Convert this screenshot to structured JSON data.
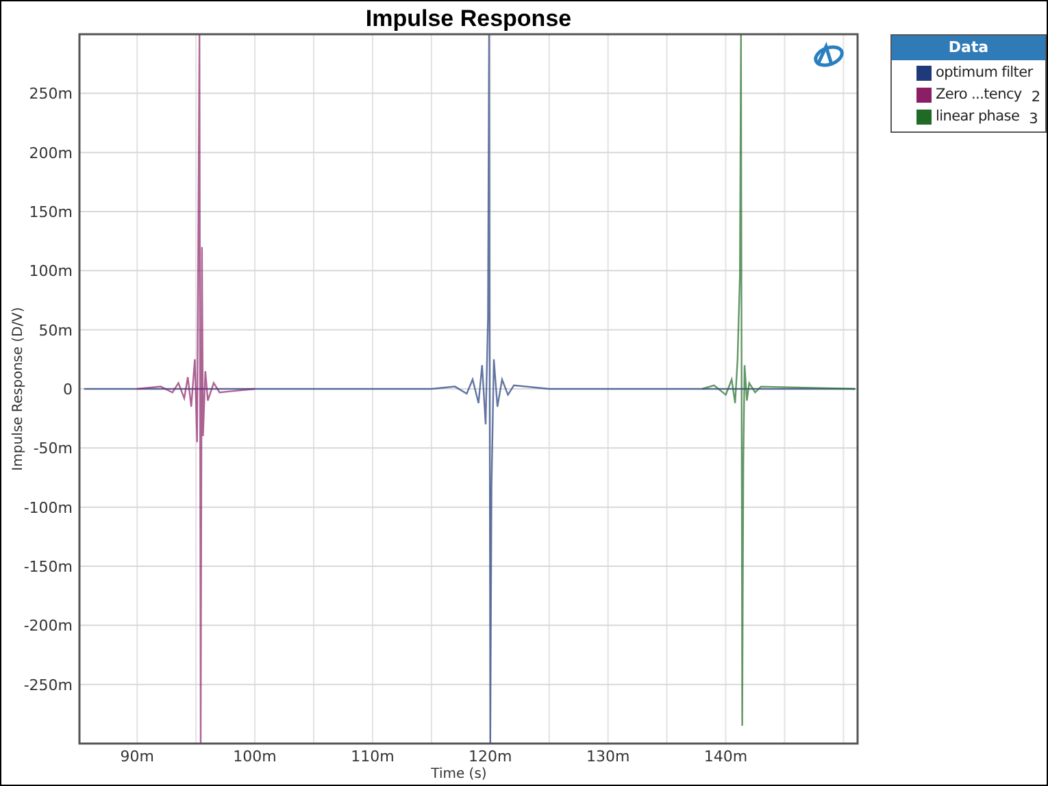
{
  "chart_data": {
    "type": "line",
    "title": "Impulse Response",
    "xlabel": "Time (s)",
    "ylabel": "Impulse Response (D/V)",
    "x": [
      85.5,
      90,
      92,
      93,
      93.5,
      94,
      94.3,
      94.6,
      94.9,
      95.1,
      95.3,
      95.4,
      95.5,
      95.6,
      95.8,
      96,
      96.5,
      97,
      98,
      100,
      105,
      115,
      117,
      118,
      118.5,
      119,
      119.3,
      119.6,
      119.8,
      119.9,
      120,
      120.1,
      120.3,
      120.6,
      121,
      121.5,
      122,
      125,
      135,
      138,
      139,
      140,
      140.5,
      140.8,
      141,
      141.2,
      141.3,
      141.4,
      141.5,
      141.6,
      141.8,
      142,
      142.5,
      143,
      151
    ],
    "series": [
      {
        "name": "optimum filter",
        "color": "#1f3a7a",
        "values": [
          0,
          0,
          0,
          0,
          0,
          0,
          0,
          0,
          0,
          0,
          0,
          0,
          0,
          0,
          0,
          0,
          0,
          0,
          0,
          0,
          0,
          0,
          2,
          -4,
          8,
          -12,
          20,
          -30,
          60,
          300,
          -300,
          -82,
          25,
          -15,
          8,
          -5,
          3,
          0,
          0,
          0,
          0,
          0,
          0,
          0,
          0,
          0,
          0,
          0,
          0,
          0,
          0,
          0,
          0,
          0,
          0
        ]
      },
      {
        "name": "Zero ...tency",
        "color": "#8a1f66",
        "values": [
          null,
          0,
          2,
          -3,
          5,
          -8,
          10,
          -15,
          25,
          -45,
          300,
          -300,
          120,
          -40,
          15,
          -10,
          5,
          -3,
          -2,
          0,
          null,
          null,
          null,
          null,
          null,
          null,
          null,
          null,
          null,
          null,
          null,
          null,
          null,
          null,
          null,
          null,
          null,
          null,
          null,
          null,
          null,
          null,
          null,
          null,
          null,
          null,
          null,
          null,
          null,
          null,
          null,
          null,
          null,
          null,
          null
        ]
      },
      {
        "name": "linear phase",
        "color": "#1f6a24",
        "values": [
          null,
          null,
          null,
          null,
          null,
          null,
          null,
          null,
          null,
          null,
          null,
          null,
          null,
          null,
          null,
          null,
          null,
          null,
          null,
          null,
          null,
          null,
          null,
          null,
          null,
          null,
          null,
          null,
          null,
          null,
          null,
          null,
          null,
          null,
          null,
          null,
          null,
          null,
          null,
          0,
          3,
          -5,
          8,
          -12,
          25,
          96,
          300,
          -285,
          -62,
          20,
          -10,
          5,
          -3,
          2,
          0
        ]
      }
    ],
    "xlim": [
      85.1,
      151.2
    ],
    "ylim": [
      -300,
      300
    ],
    "grid": true,
    "xticks": [
      {
        "value": 90,
        "label": "90m"
      },
      {
        "value": 100,
        "label": "100m"
      },
      {
        "value": 110,
        "label": "110m"
      },
      {
        "value": 120,
        "label": "120m"
      },
      {
        "value": 130,
        "label": "130m"
      },
      {
        "value": 140,
        "label": "140m"
      }
    ],
    "yticks": [
      {
        "value": -250,
        "label": "-250m"
      },
      {
        "value": -200,
        "label": "-200m"
      },
      {
        "value": -150,
        "label": "-150m"
      },
      {
        "value": -100,
        "label": "-100m"
      },
      {
        "value": -50,
        "label": "-50m"
      },
      {
        "value": 0,
        "label": "0"
      },
      {
        "value": 50,
        "label": "50m"
      },
      {
        "value": 100,
        "label": "100m"
      },
      {
        "value": 150,
        "label": "150m"
      },
      {
        "value": 200,
        "label": "200m"
      },
      {
        "value": 250,
        "label": "250m"
      }
    ]
  },
  "legend": {
    "title": "Data",
    "numbers": [
      "2",
      "3"
    ]
  }
}
